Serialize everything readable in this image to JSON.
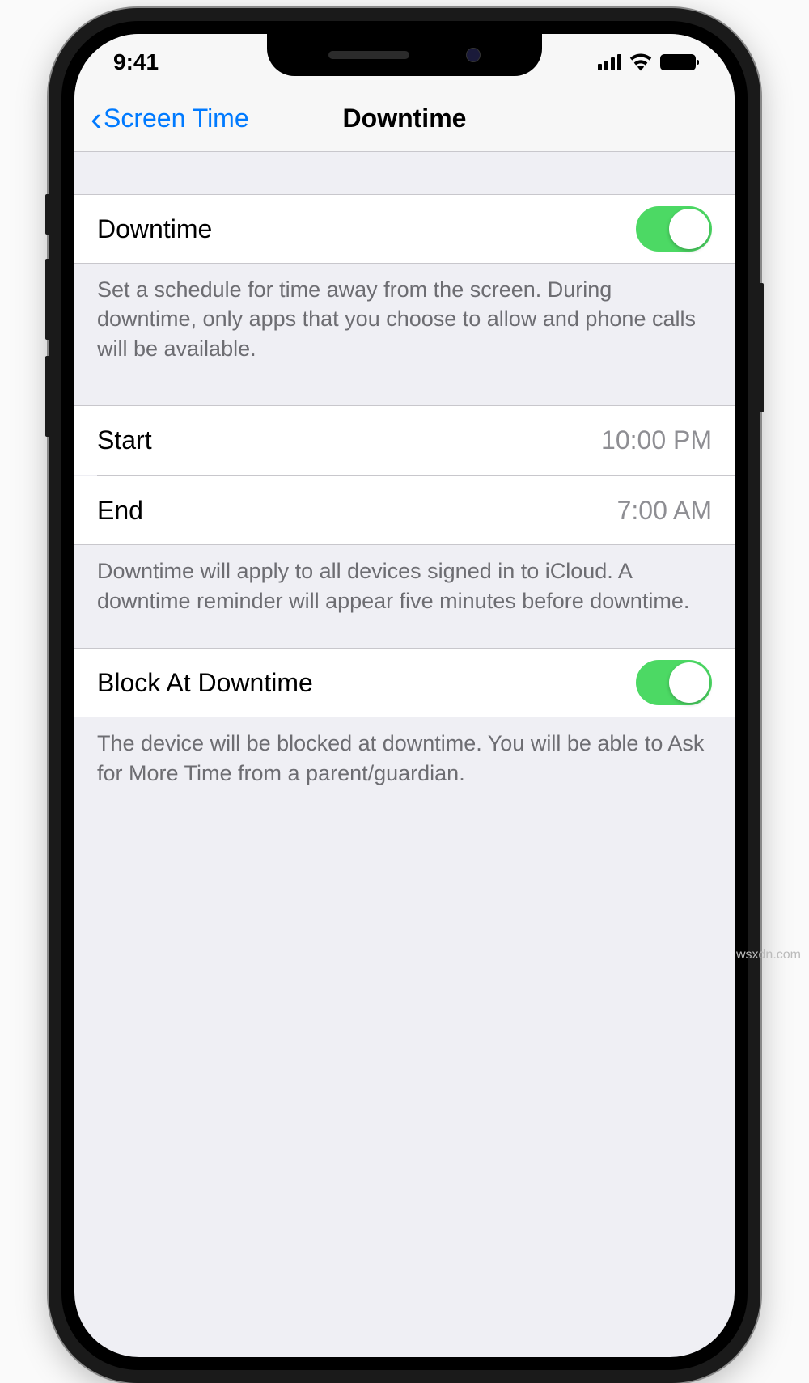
{
  "status_bar": {
    "time": "9:41"
  },
  "nav": {
    "back_label": "Screen Time",
    "title": "Downtime"
  },
  "section1": {
    "toggle_label": "Downtime",
    "toggle_on": true,
    "footer": "Set a schedule for time away from the screen. During downtime, only apps that you choose to allow and phone calls will be available."
  },
  "section2": {
    "start_label": "Start",
    "start_value": "10:00 PM",
    "end_label": "End",
    "end_value": "7:00 AM",
    "footer": "Downtime will apply to all devices signed in to iCloud. A downtime reminder will appear five minutes before downtime."
  },
  "section3": {
    "toggle_label": "Block At Downtime",
    "toggle_on": true,
    "footer": "The device will be blocked at downtime. You will be able to Ask for More Time from a parent/guardian."
  },
  "watermark": "wsxdn.com"
}
